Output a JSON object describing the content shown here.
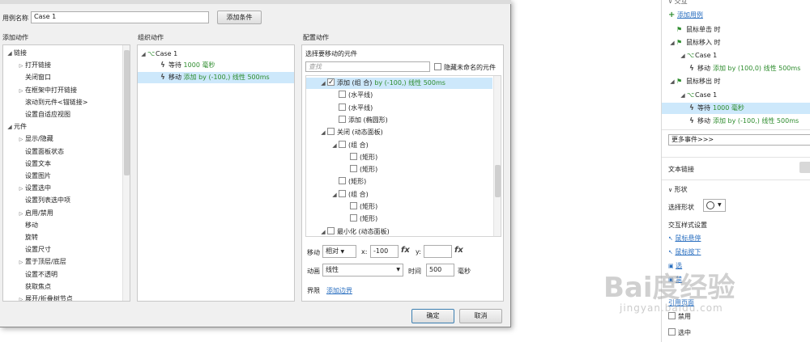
{
  "dialog": {
    "case_name_label": "用例名称",
    "case_name_value": "Case 1",
    "add_condition_button": "添加条件",
    "add_action_title": "添加动作",
    "organize_title": "组织动作",
    "configure_title": "配置动作",
    "ok_button": "确定",
    "cancel_button": "取消"
  },
  "add_actions": [
    {
      "label": "链接",
      "level": 0,
      "toggle": "open"
    },
    {
      "label": "打开链接",
      "level": 1,
      "toggle": "closed"
    },
    {
      "label": "关闭窗口",
      "level": 1,
      "toggle": "none"
    },
    {
      "label": "在框架中打开链接",
      "level": 1,
      "toggle": "closed"
    },
    {
      "label": "滚动到元件<锚链接>",
      "level": 1,
      "toggle": "none"
    },
    {
      "label": "设置自适应视图",
      "level": 1,
      "toggle": "none"
    },
    {
      "label": "元件",
      "level": 0,
      "toggle": "open"
    },
    {
      "label": "显示/隐藏",
      "level": 1,
      "toggle": "closed"
    },
    {
      "label": "设置面板状态",
      "level": 1,
      "toggle": "none"
    },
    {
      "label": "设置文本",
      "level": 1,
      "toggle": "none"
    },
    {
      "label": "设置图片",
      "level": 1,
      "toggle": "none"
    },
    {
      "label": "设置选中",
      "level": 1,
      "toggle": "closed"
    },
    {
      "label": "设置列表选中项",
      "level": 1,
      "toggle": "none"
    },
    {
      "label": "启用/禁用",
      "level": 1,
      "toggle": "closed"
    },
    {
      "label": "移动",
      "level": 1,
      "toggle": "none"
    },
    {
      "label": "旋转",
      "level": 1,
      "toggle": "none"
    },
    {
      "label": "设置尺寸",
      "level": 1,
      "toggle": "none"
    },
    {
      "label": "置于顶层/底层",
      "level": 1,
      "toggle": "closed"
    },
    {
      "label": "设置不透明",
      "level": 1,
      "toggle": "none"
    },
    {
      "label": "获取焦点",
      "level": 1,
      "toggle": "none"
    },
    {
      "label": "展开/折叠树节点",
      "level": 1,
      "toggle": "closed"
    }
  ],
  "organize": {
    "case_label": "Case 1",
    "wait_prefix": "等待",
    "wait_value": "1000 毫秒",
    "move_prefix": "移动",
    "move_value": "添加 by (-100,) 线性 500ms"
  },
  "configure": {
    "select_title": "选择要移动的元件",
    "search_placeholder": "查找",
    "hide_unnamed_label": "隐藏未命名的元件",
    "tree": [
      {
        "label": "添加 (组 合)",
        "suffix": "by (-100,) 线性 500ms",
        "level": 0,
        "toggle": "open",
        "checked": true,
        "selected": true
      },
      {
        "label": "(水平线)",
        "suffix": "",
        "level": 1,
        "toggle": "none",
        "checked": false,
        "selected": false
      },
      {
        "label": "(水平线)",
        "suffix": "",
        "level": 1,
        "toggle": "none",
        "checked": false,
        "selected": false
      },
      {
        "label": "添加 (椭圆形)",
        "suffix": "",
        "level": 1,
        "toggle": "none",
        "checked": false,
        "selected": false
      },
      {
        "label": "关闭 (动态面板)",
        "suffix": "",
        "level": 0,
        "toggle": "open",
        "checked": false,
        "selected": false
      },
      {
        "label": "(组 合)",
        "suffix": "",
        "level": 1,
        "toggle": "open",
        "checked": false,
        "selected": false
      },
      {
        "label": "(矩形)",
        "suffix": "",
        "level": 2,
        "toggle": "none",
        "checked": false,
        "selected": false
      },
      {
        "label": "(矩形)",
        "suffix": "",
        "level": 2,
        "toggle": "none",
        "checked": false,
        "selected": false
      },
      {
        "label": "(矩形)",
        "suffix": "",
        "level": 1,
        "toggle": "none",
        "checked": false,
        "selected": false
      },
      {
        "label": "(组 合)",
        "suffix": "",
        "level": 1,
        "toggle": "open",
        "checked": false,
        "selected": false
      },
      {
        "label": "(矩形)",
        "suffix": "",
        "level": 2,
        "toggle": "none",
        "checked": false,
        "selected": false
      },
      {
        "label": "(矩形)",
        "suffix": "",
        "level": 2,
        "toggle": "none",
        "checked": false,
        "selected": false
      },
      {
        "label": "最小化 (动态面板)",
        "suffix": "",
        "level": 0,
        "toggle": "open",
        "checked": false,
        "selected": false
      }
    ],
    "move_label": "移动",
    "move_mode": "相对",
    "x_label": "x:",
    "x_value": "-100",
    "fx": "fx",
    "y_label": "y:",
    "y_value": "",
    "anim_label": "动画",
    "anim_value": "线性",
    "time_label": "时间",
    "time_value": "500",
    "time_unit": "毫秒",
    "bounds_label": "界限",
    "bounds_link": "添加边界"
  },
  "right_panel": {
    "top_partial": "交互",
    "add_case": "添加用例",
    "events": [
      {
        "type": "event",
        "label": "鼠标单击 时",
        "level": 0
      },
      {
        "type": "event",
        "label": "鼠标移入 时",
        "level": 0
      },
      {
        "type": "case",
        "label": "Case 1",
        "level": 1
      },
      {
        "type": "action",
        "prefix": "移动",
        "value": "添加 by (100,0) 线性 500ms",
        "level": 2
      },
      {
        "type": "event",
        "label": "鼠标移出 时",
        "level": 0
      },
      {
        "type": "case",
        "label": "Case 1",
        "level": 1
      },
      {
        "type": "action",
        "prefix": "等待",
        "value": "1000 毫秒",
        "level": 2
      },
      {
        "type": "action",
        "prefix": "移动",
        "value": "添加 by (-100,) 线性 500ms",
        "level": 2
      }
    ],
    "more_events": "更多事件>>>",
    "text_link": "文本链接",
    "shape_section": "形状",
    "select_shape": "选择形状",
    "interaction_styles": "交互样式设置",
    "mouse_hover": "鼠标悬停",
    "mouse_down": "鼠标按下",
    "selected_short": "选",
    "disabled_short": "禁",
    "reference_page": "引用页面",
    "disable": "禁用",
    "selected": "选中"
  },
  "watermark": {
    "text_cn": "Bai度经验",
    "text_url": "jingyan.baidu.com"
  }
}
